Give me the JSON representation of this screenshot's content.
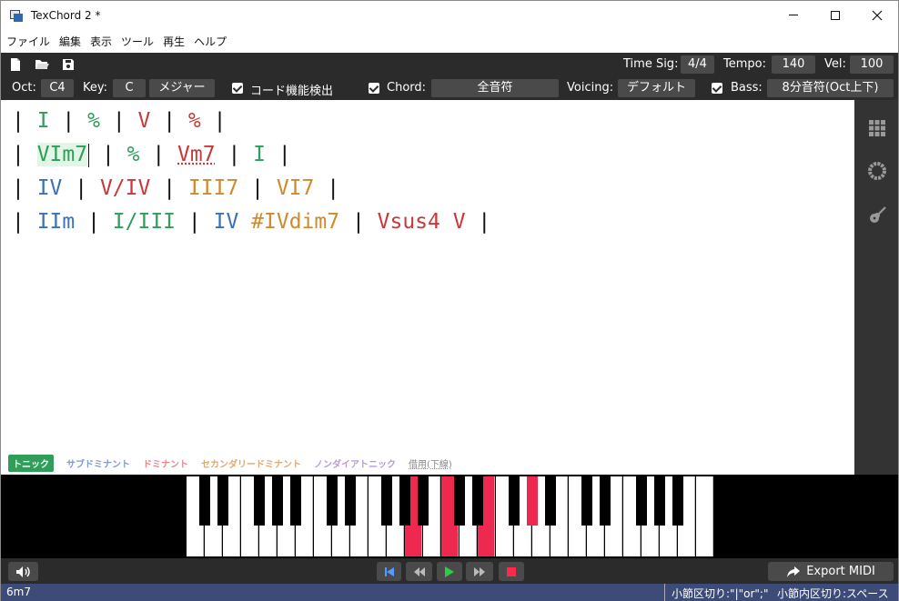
{
  "window": {
    "title": "TexChord 2 *"
  },
  "menu": [
    "ファイル",
    "編集",
    "表示",
    "ツール",
    "再生",
    "ヘルプ"
  ],
  "toolbar1": {
    "icons": [
      "new-file-icon",
      "open-folder-icon",
      "save-icon"
    ],
    "time_sig_label": "Time Sig:",
    "time_sig_value": "4/4",
    "tempo_label": "Tempo:",
    "tempo_value": "140",
    "vel_label": "Vel:",
    "vel_value": "100"
  },
  "toolbar2": {
    "oct_label": "Oct:",
    "oct_value": "C4",
    "key_label": "Key:",
    "key_value": "C",
    "mode_value": "メジャー",
    "detect_label": "コード機能検出",
    "chord_label": "Chord:",
    "chord_value": "全音符",
    "voicing_label": "Voicing:",
    "voicing_value": "デフォルト",
    "bass_label": "Bass:",
    "bass_value": "8分音符(Oct上下)"
  },
  "editor": {
    "lines": [
      [
        {
          "text": "| ",
          "fn": "bar"
        },
        {
          "text": "I",
          "fn": "t"
        },
        {
          "text": " | ",
          "fn": "bar"
        },
        {
          "text": "%",
          "fn": "t"
        },
        {
          "text": " | ",
          "fn": "bar"
        },
        {
          "text": "V",
          "fn": "d"
        },
        {
          "text": " | ",
          "fn": "bar"
        },
        {
          "text": "%",
          "fn": "d"
        },
        {
          "text": " |",
          "fn": "bar"
        }
      ],
      [
        {
          "text": "| ",
          "fn": "bar"
        },
        {
          "text": "VIm7",
          "fn": "t cursor-box"
        },
        {
          "text": " | ",
          "fn": "bar"
        },
        {
          "text": "%",
          "fn": "t"
        },
        {
          "text": " | ",
          "fn": "bar"
        },
        {
          "text": "Vm7",
          "fn": "d borrowed"
        },
        {
          "text": " | ",
          "fn": "bar"
        },
        {
          "text": "I",
          "fn": "t"
        },
        {
          "text": " |",
          "fn": "bar"
        }
      ],
      [
        {
          "text": "| ",
          "fn": "bar"
        },
        {
          "text": "IV",
          "fn": "s"
        },
        {
          "text": " | ",
          "fn": "bar"
        },
        {
          "text": "V/IV",
          "fn": "d"
        },
        {
          "text": " | ",
          "fn": "bar"
        },
        {
          "text": "III7",
          "fn": "sec"
        },
        {
          "text": " | ",
          "fn": "bar"
        },
        {
          "text": "VI7",
          "fn": "sec"
        },
        {
          "text": " |",
          "fn": "bar"
        }
      ],
      [
        {
          "text": "| ",
          "fn": "bar"
        },
        {
          "text": "IIm",
          "fn": "s"
        },
        {
          "text": " | ",
          "fn": "bar"
        },
        {
          "text": "I/III",
          "fn": "t"
        },
        {
          "text": " | ",
          "fn": "bar"
        },
        {
          "text": "IV",
          "fn": "s"
        },
        {
          "text": " ",
          "fn": "bar"
        },
        {
          "text": "#IVdim7",
          "fn": "sec"
        },
        {
          "text": " | ",
          "fn": "bar"
        },
        {
          "text": "Vsus4 V",
          "fn": "d"
        },
        {
          "text": " |",
          "fn": "bar"
        }
      ]
    ]
  },
  "legend": {
    "tonic": "トニック",
    "subdominant": "サブドミナント",
    "dominant": "ドミナント",
    "secondary": "セカンダリードミナント",
    "non_diatonic": "ノンダイアトニック",
    "borrowed": "借用(下線)"
  },
  "colors": {
    "tonic": "#2e9e58",
    "subdominant": "#3a72b8",
    "dominant": "#c8393b",
    "secondary": "#d08a2e",
    "highlight_key": "#ef2850",
    "bass_key": "#6b6bff"
  },
  "side_panel": [
    "grid-icon",
    "circle-of-fifths-icon",
    "guitar-icon"
  ],
  "transport": {
    "volume_icon": "speaker-icon",
    "buttons": [
      "skip-start-icon",
      "rewind-icon",
      "play-icon",
      "fast-forward-icon",
      "stop-icon"
    ],
    "export_label": "Export MIDI"
  },
  "status": {
    "current_chord": "6m7",
    "hint1": "小節区切り:\"|\"or\";\"",
    "hint2": "小節内区切り:スペース"
  }
}
